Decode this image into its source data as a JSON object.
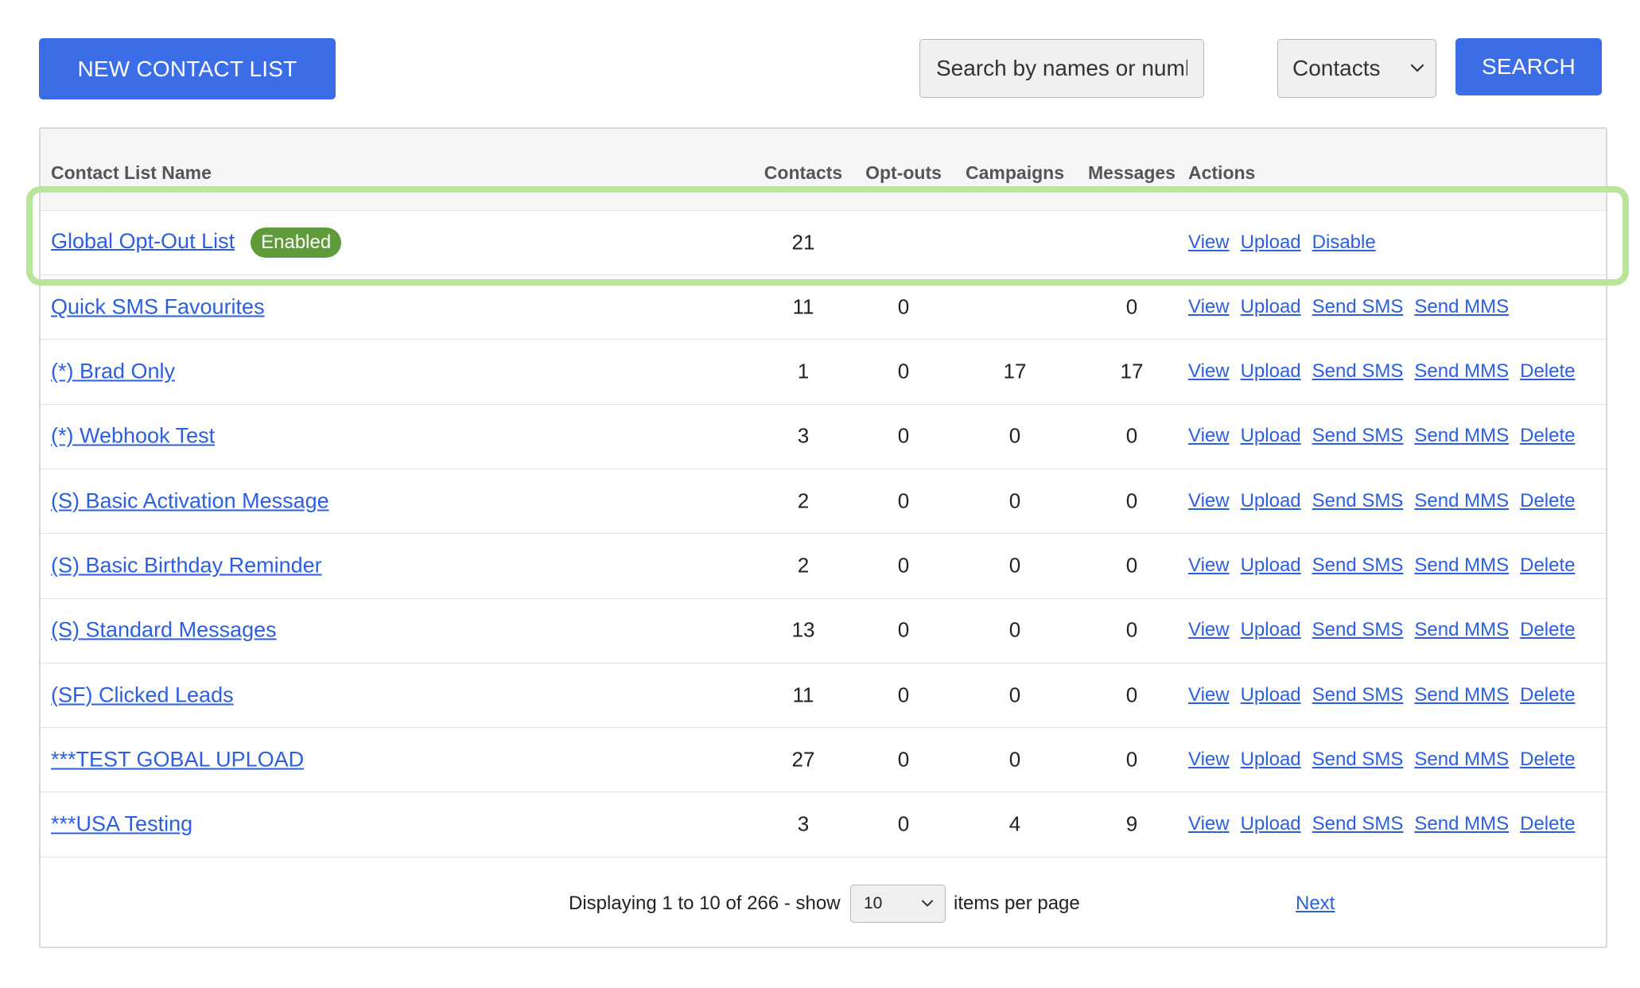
{
  "toolbar": {
    "new_list_label": "NEW CONTACT LIST",
    "search_placeholder": "Search by names or numbers...",
    "search_scope": "Contacts",
    "search_label": "SEARCH"
  },
  "table": {
    "columns": {
      "name": "Contact List Name",
      "contacts": "Contacts",
      "optouts": "Opt-outs",
      "campaigns": "Campaigns",
      "messages": "Messages",
      "actions": "Actions"
    },
    "rows": [
      {
        "name": "Global Opt-Out List",
        "badge": "Enabled",
        "contacts": "21",
        "optouts": "",
        "campaigns": "",
        "messages": "",
        "actions": [
          "View",
          "Upload",
          "Disable"
        ]
      },
      {
        "name": "Quick SMS Favourites",
        "contacts": "11",
        "optouts": "0",
        "campaigns": "",
        "messages": "0",
        "actions": [
          "View",
          "Upload",
          "Send SMS",
          "Send MMS"
        ]
      },
      {
        "name": "(*) Brad Only",
        "contacts": "1",
        "optouts": "0",
        "campaigns": "17",
        "messages": "17",
        "actions": [
          "View",
          "Upload",
          "Send SMS",
          "Send MMS",
          "Delete"
        ]
      },
      {
        "name": "(*) Webhook Test",
        "contacts": "3",
        "optouts": "0",
        "campaigns": "0",
        "messages": "0",
        "actions": [
          "View",
          "Upload",
          "Send SMS",
          "Send MMS",
          "Delete"
        ]
      },
      {
        "name": "(S) Basic Activation Message",
        "contacts": "2",
        "optouts": "0",
        "campaigns": "0",
        "messages": "0",
        "actions": [
          "View",
          "Upload",
          "Send SMS",
          "Send MMS",
          "Delete"
        ]
      },
      {
        "name": "(S) Basic Birthday Reminder",
        "contacts": "2",
        "optouts": "0",
        "campaigns": "0",
        "messages": "0",
        "actions": [
          "View",
          "Upload",
          "Send SMS",
          "Send MMS",
          "Delete"
        ]
      },
      {
        "name": "(S) Standard Messages",
        "contacts": "13",
        "optouts": "0",
        "campaigns": "0",
        "messages": "0",
        "actions": [
          "View",
          "Upload",
          "Send SMS",
          "Send MMS",
          "Delete"
        ]
      },
      {
        "name": "(SF) Clicked Leads",
        "contacts": "11",
        "optouts": "0",
        "campaigns": "0",
        "messages": "0",
        "actions": [
          "View",
          "Upload",
          "Send SMS",
          "Send MMS",
          "Delete"
        ]
      },
      {
        "name": "***TEST GOBAL UPLOAD",
        "contacts": "27",
        "optouts": "0",
        "campaigns": "0",
        "messages": "0",
        "actions": [
          "View",
          "Upload",
          "Send SMS",
          "Send MMS",
          "Delete"
        ]
      },
      {
        "name": "***USA Testing",
        "contacts": "3",
        "optouts": "0",
        "campaigns": "4",
        "messages": "9",
        "actions": [
          "View",
          "Upload",
          "Send SMS",
          "Send MMS",
          "Delete"
        ]
      }
    ]
  },
  "pagination": {
    "display_text": "Displaying 1 to 10 of 266 - show",
    "per_page_value": "10",
    "per_page_suffix": "items per page",
    "next_label": "Next"
  },
  "colors": {
    "primary": "#3b6ee6",
    "link": "#2c5fe0",
    "badge": "#5f9b3a",
    "highlight": "#b9e49b"
  },
  "icons": {
    "select_arrow": "chevron-down-icon"
  }
}
